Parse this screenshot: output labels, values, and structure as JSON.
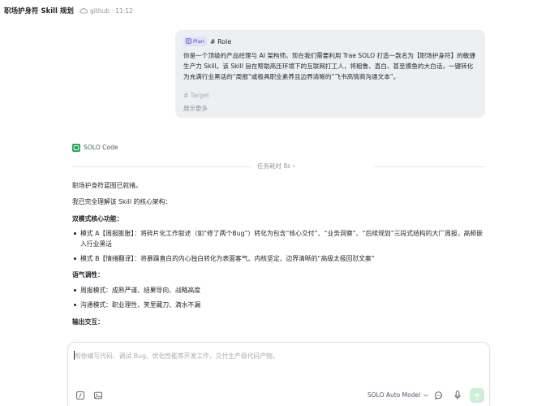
{
  "header": {
    "title": "职场护身符 Skill 规划",
    "meta": "github · 11:12",
    "cloud_icon": "cloud-icon"
  },
  "user_message": {
    "tag_label": "Plan",
    "tag_icon": "plan-icon",
    "role_heading": "# Role",
    "paragraph": "你是一个顶级的产品经理与 AI 架构师。现在我们需要利用 Trae SOLO 打造一款名为【职场护身符】的敏捷生产力 Skill。该 Skill 旨在帮助高压环境下的互联网打工人，将粗鲁、直白、甚至摸鱼的大白话，一键转化为充满行业黑话的“周报”或极具职业素养且边界清晰的“飞书高情商沟通文本”。",
    "target_heading": "# Target",
    "show_more": "展示更多"
  },
  "assistant": {
    "name": "SOLO Code",
    "task_time": "任务耗时 8s",
    "line1": "职场护身符蓝图已就绪。",
    "line2": "我已完全理解该 Skill 的核心架构：",
    "section1_title": "双模式核心功能：",
    "bullets1": [
      "模式 A【周报膨胀】：将碎片化工作叙述（如“修了两个Bug”）转化为包含“核心交付”、“业务洞察”、“后续规划”三段式结构的大厂周报，高频嵌入行业黑话",
      "模式 B【情绪翻译】：将暴躁直白的内心独白转化为表面客气、内核坚定、边界清晰的“高级太极回怼文案”"
    ],
    "section2_title": "语气调性：",
    "bullets2": [
      "周报模式：成熟严谨、结果导向、战略高度",
      "沟通模式：职业理性、笑里藏刀、滴水不漏"
    ],
    "section3_title": "输出交互："
  },
  "composer": {
    "placeholder": "帮你编写代码、调试 Bug、优化性能等开发工作，交付生产级代码产物。",
    "model_label": "SOLO Auto Model",
    "tools": [
      "slash-command-icon",
      "image-icon",
      "chat-icon",
      "microphone-icon",
      "send-arrow-icon"
    ]
  },
  "colors": {
    "accent_green": "#23a55a",
    "plan_purple": "#5b4bc4",
    "bubble_bg": "#eeeff3",
    "send_bg": "#cfeed8"
  }
}
